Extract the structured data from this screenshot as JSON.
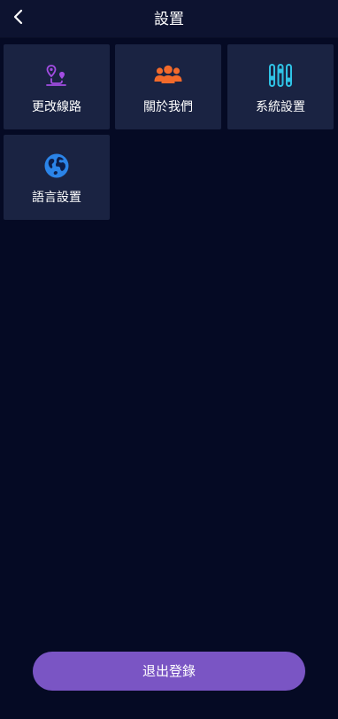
{
  "header": {
    "title": "設置",
    "back_icon": "chevron-left-icon"
  },
  "tiles": [
    {
      "label": "更改線路",
      "icon": "route-pin-icon",
      "color": "#a34de3"
    },
    {
      "label": "關於我們",
      "icon": "users-group-icon",
      "color": "#f26a2b"
    },
    {
      "label": "系統設置",
      "icon": "sliders-icon",
      "color": "#2fc3e6"
    },
    {
      "label": "語言設置",
      "icon": "globe-icon",
      "color": "#2b84e8"
    }
  ],
  "logout": {
    "label": "退出登錄",
    "color": "#7a55c4"
  }
}
